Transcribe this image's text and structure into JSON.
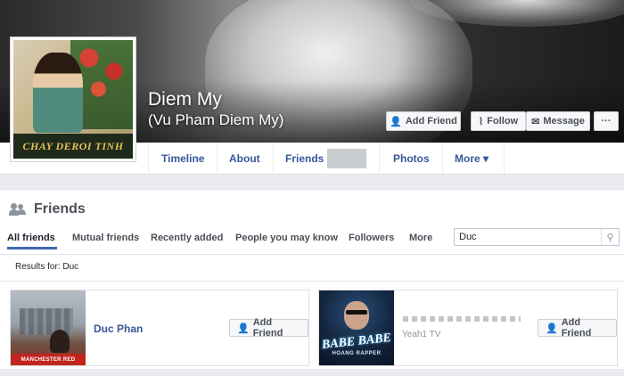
{
  "profile": {
    "name": "Diem My",
    "alt_name": "(Vu Pham Diem My)",
    "pic_caption": "CHAY DEROI TINH"
  },
  "cover_actions": {
    "add_friend": "Add Friend",
    "follow": "Follow",
    "message": "Message",
    "more": "···"
  },
  "nav": {
    "tabs": [
      "Timeline",
      "About",
      "Friends",
      "Photos",
      "More ▾"
    ]
  },
  "friends": {
    "title": "Friends",
    "filters": [
      "All friends",
      "Mutual friends",
      "Recently added",
      "People you may know",
      "Followers",
      "More"
    ],
    "search_value": "Duc",
    "results_text": "Results for: Duc"
  },
  "cards": [
    {
      "name": "Duc Phan",
      "subtitle": "",
      "button": "Add Friend",
      "thumb_text": "MANCHESTER    RED"
    },
    {
      "name": "",
      "subtitle": "Yeah1 TV",
      "button": "Add Friend",
      "thumb_text": "BABE BABE",
      "thumb_subtext": "HOANG RAPPER"
    }
  ],
  "colors": {
    "link_blue": "#365899",
    "accent": "#4267b2",
    "background": "#e9ebee"
  }
}
